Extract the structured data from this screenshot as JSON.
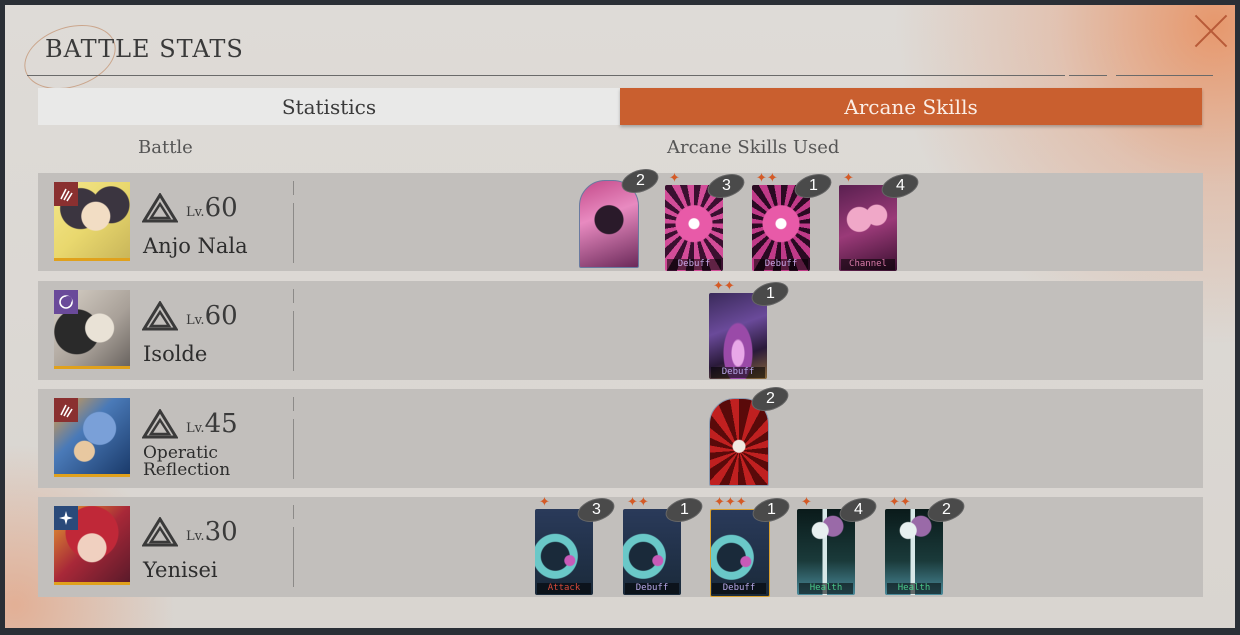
{
  "window": {
    "title": "BATTLE STATS"
  },
  "tabs": [
    {
      "label": "Statistics",
      "active": false
    },
    {
      "label": "Arcane Skills",
      "active": true
    }
  ],
  "columns": {
    "battle": "Battle",
    "skills": "Arcane Skills Used"
  },
  "level_prefix": "Lv.",
  "colors": {
    "accent": "#c95f2f",
    "stars": "#d45a26",
    "row_bg": "#c2bfbc"
  },
  "characters": [
    {
      "name": "Anjo Nala",
      "level": "60",
      "class_icon": "claw-icon",
      "skills": [
        {
          "stars": "",
          "count": "2",
          "label": ""
        },
        {
          "stars": "✦",
          "count": "3",
          "label": "Debuff"
        },
        {
          "stars": "✦✦",
          "count": "1",
          "label": "Debuff"
        },
        {
          "stars": "✦",
          "count": "4",
          "label": "Channel"
        }
      ]
    },
    {
      "name": "Isolde",
      "level": "60",
      "class_icon": "crescent-icon",
      "skills": [
        {
          "stars": "✦✦",
          "count": "1",
          "label": "Debuff"
        }
      ]
    },
    {
      "name": "Operatic Reflection",
      "name_line1": "Operatic",
      "name_line2": "Reflection",
      "level": "45",
      "class_icon": "claw-icon",
      "skills": [
        {
          "stars": "",
          "count": "2",
          "label": ""
        }
      ]
    },
    {
      "name": "Yenisei",
      "level": "30",
      "class_icon": "star-burst-icon",
      "skills": [
        {
          "stars": "✦",
          "count": "3",
          "label": "Attack"
        },
        {
          "stars": "✦✦",
          "count": "1",
          "label": "Debuff"
        },
        {
          "stars": "✦✦✦",
          "count": "1",
          "label": "Debuff"
        },
        {
          "stars": "✦",
          "count": "4",
          "label": "Health"
        },
        {
          "stars": "✦✦",
          "count": "2",
          "label": "Health"
        }
      ]
    }
  ]
}
